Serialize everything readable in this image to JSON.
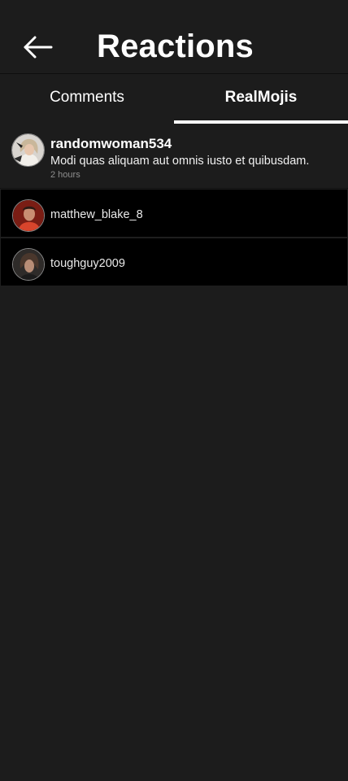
{
  "header": {
    "title": "Reactions",
    "back_icon": "arrow-left-icon"
  },
  "tabs": [
    {
      "label": "Comments",
      "active": false
    },
    {
      "label": "RealMojis",
      "active": true
    }
  ],
  "post": {
    "username": "randomwoman534",
    "comment": "Modi quas aliquam aut omnis iusto et quibusdam.",
    "time": "2 hours"
  },
  "reactions": [
    {
      "username": "matthew_blake_8"
    },
    {
      "username": "toughguy2009"
    }
  ],
  "colors": {
    "background": "#1c1c1c",
    "row_background": "#000000",
    "text": "#ffffff",
    "muted": "#8f8f8f"
  }
}
